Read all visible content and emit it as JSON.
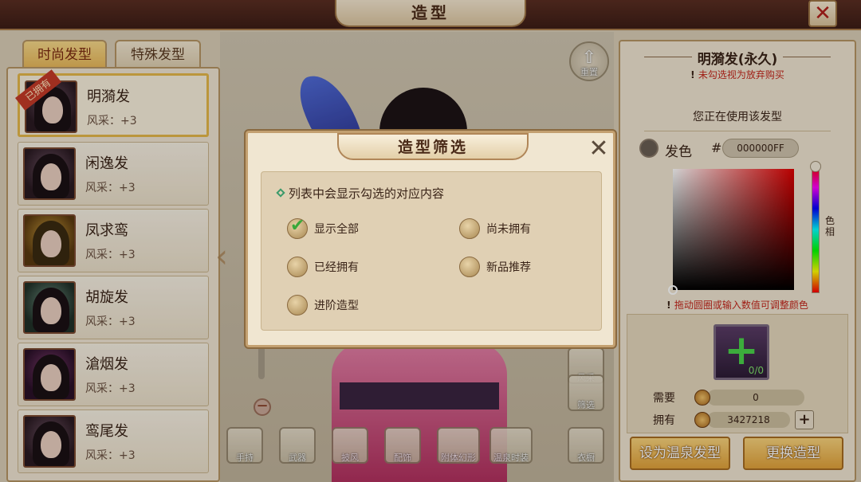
{
  "window": {
    "title": "造型",
    "close_label": "✕"
  },
  "tabs": {
    "fashion": "时尚发型",
    "special": "特殊发型"
  },
  "hair_list": [
    {
      "name": "明漪发",
      "stat": "风采：+3",
      "owned_badge": "已拥有"
    },
    {
      "name": "闲逸发",
      "stat": "风采：+3"
    },
    {
      "name": "凤求鸾",
      "stat": "风采：+3"
    },
    {
      "name": "胡旋发",
      "stat": "风采：+3"
    },
    {
      "name": "滄烟发",
      "stat": "风采：+3"
    },
    {
      "name": "鸾尾发",
      "stat": "风采：+3"
    }
  ],
  "scene": {
    "reset_label": "重置",
    "style_label": "风采",
    "filter_label": "筛选",
    "wardrobe_label": "衣橱",
    "bottom_buttons": [
      "手持",
      "武器",
      "披风",
      "配饰",
      "附体幻形",
      "温泉时装"
    ]
  },
  "right_panel": {
    "title": "明漪发(永久)",
    "warning": "未勾选视为放弃购买",
    "using": "您正在使用该发型",
    "color_label": "发色",
    "hash": "#",
    "hex_value": "000000FF",
    "hue_label": "色相",
    "hint": "拖动圆圈或输入数值可调整颜色",
    "item_count": "0/0",
    "need_label": "需要",
    "need_value": "0",
    "own_label": "拥有",
    "own_value": "3427218",
    "plus": "+",
    "btn_hotspring": "设为温泉发型",
    "btn_change": "更换造型"
  },
  "modal": {
    "title": "造型筛选",
    "close": "✕",
    "description": "列表中会显示勾选的对应内容",
    "options": [
      {
        "label": "显示全部",
        "checked": true
      },
      {
        "label": "尚未拥有",
        "checked": false
      },
      {
        "label": "已经拥有",
        "checked": false
      },
      {
        "label": "新品推荐",
        "checked": false
      },
      {
        "label": "进阶造型",
        "checked": false
      }
    ]
  }
}
